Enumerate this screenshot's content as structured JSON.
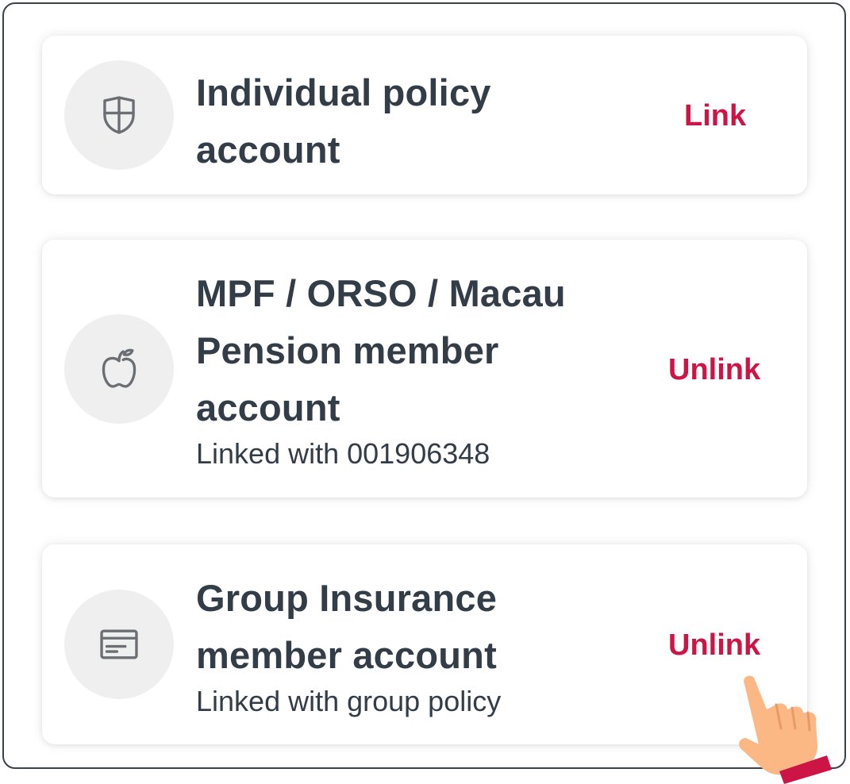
{
  "accounts": [
    {
      "title": "Individual policy account",
      "subtitle": "",
      "action": "Link",
      "icon": "shield-icon"
    },
    {
      "title": "MPF / ORSO / Macau Pension member account",
      "subtitle": "Linked with 001906348",
      "action": "Unlink",
      "icon": "apple-icon"
    },
    {
      "title": "Group Insurance member account",
      "subtitle": "Linked with group policy",
      "action": "Unlink",
      "icon": "card-icon"
    }
  ],
  "pointer_icon": "pointing-hand-icon",
  "colors": {
    "accent": "#cc1445",
    "text": "#333d47",
    "icon_bg": "#efefef",
    "hand_skin": "#fbb784",
    "hand_cuff": "#cc1445"
  }
}
